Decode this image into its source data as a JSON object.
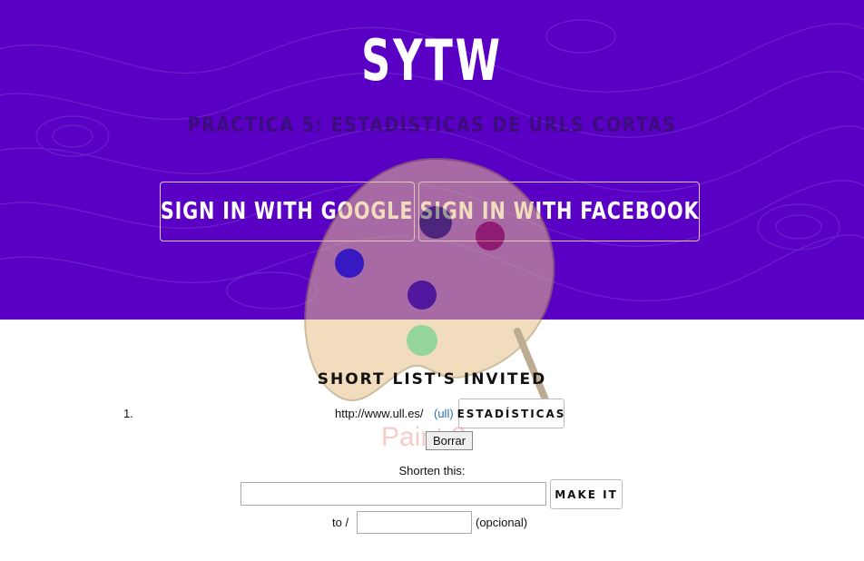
{
  "header": {
    "title": "SYTW",
    "subtitle": "PRÁCTICA 5: ESTADÍSTICAS DE URLS CORTAS",
    "google_button": "SIGN IN WITH GOOGLE",
    "facebook_button": "SIGN IN WITH FACEBOOK",
    "background_color": "#5a00c4"
  },
  "list": {
    "title": "SHORT LIST'S INVITED",
    "items": [
      {
        "number": "1.",
        "url": "http://www.ull.es/",
        "short_link": "(ull)",
        "stats_button": "ESTADÍSTICAS",
        "delete_button": "Borrar"
      }
    ]
  },
  "watermark": "Paint 2",
  "form": {
    "shorten_label": "Shorten this:",
    "url_value": "",
    "submit_button": "MAKE IT",
    "to_label": "to /",
    "alias_value": "",
    "optional_label": "(opcional)"
  }
}
